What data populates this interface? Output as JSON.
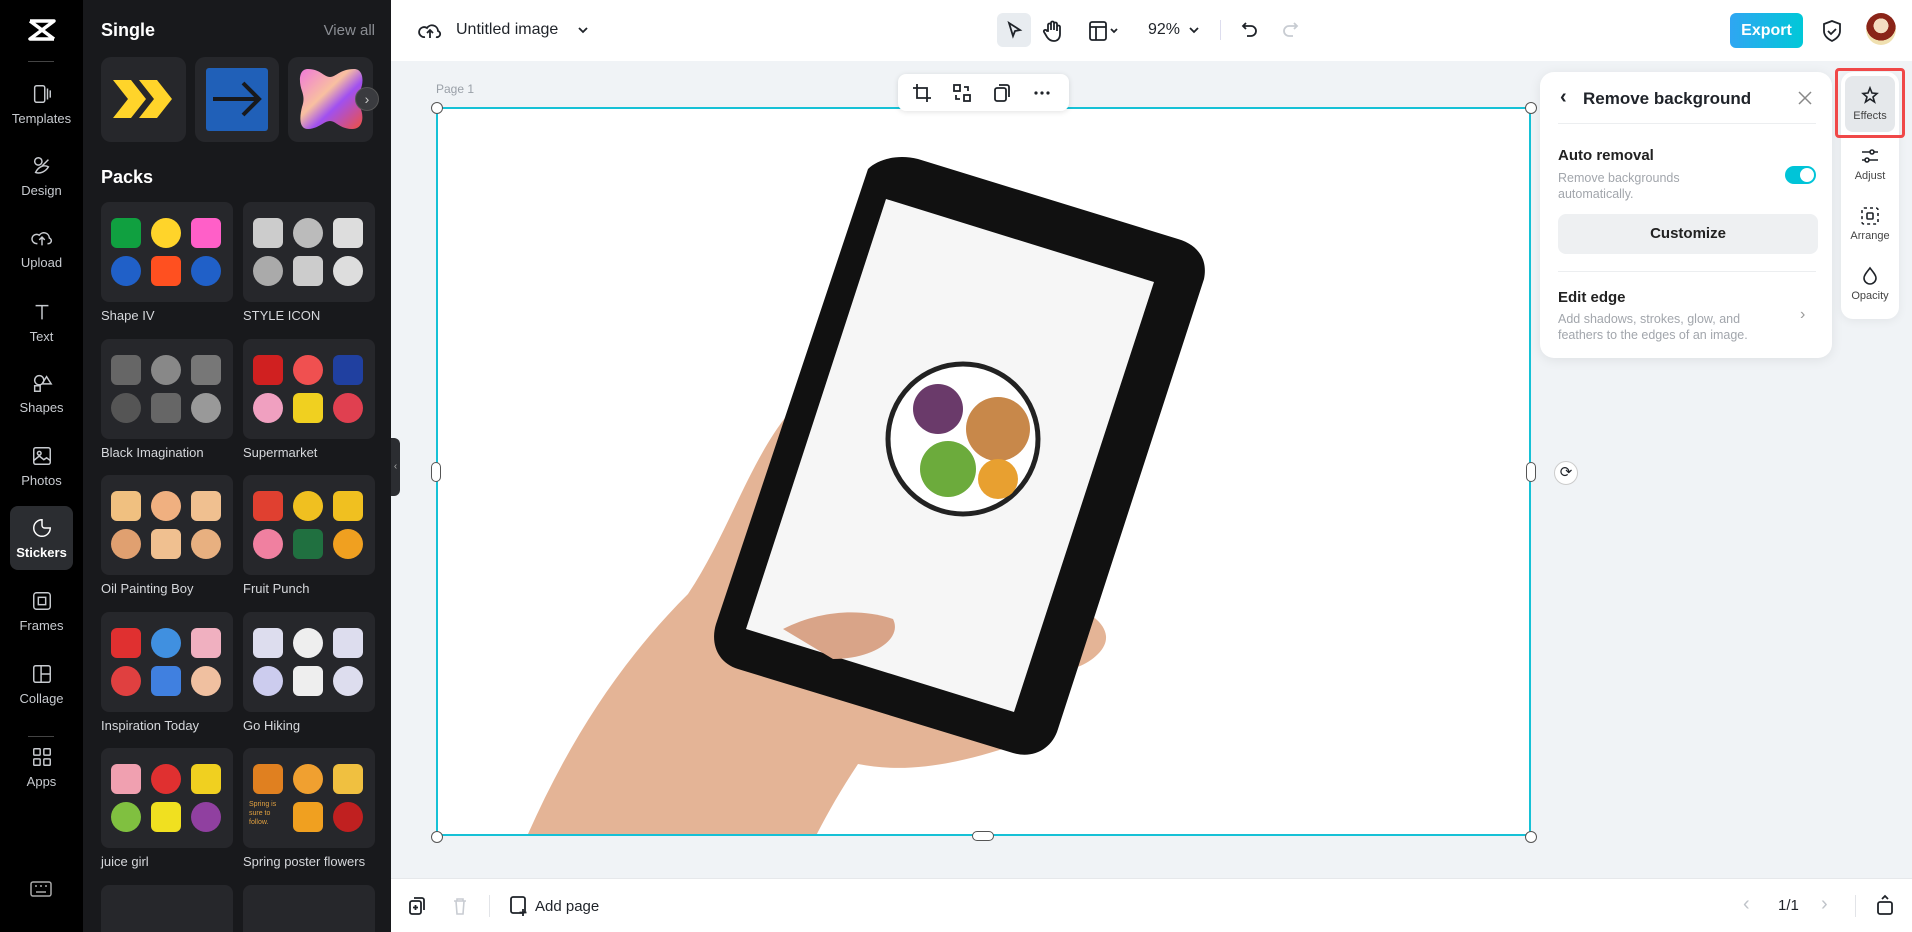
{
  "rail": {
    "items": [
      {
        "label": "Templates",
        "icon": "templates-icon"
      },
      {
        "label": "Design",
        "icon": "design-icon"
      },
      {
        "label": "Upload",
        "icon": "upload-cloud-icon"
      },
      {
        "label": "Text",
        "icon": "text-icon"
      },
      {
        "label": "Shapes",
        "icon": "shapes-icon"
      },
      {
        "label": "Photos",
        "icon": "photo-icon"
      },
      {
        "label": "Stickers",
        "icon": "sticker-icon",
        "active": true
      },
      {
        "label": "Frames",
        "icon": "frame-icon"
      },
      {
        "label": "Collage",
        "icon": "collage-icon"
      },
      {
        "label": "Apps",
        "icon": "apps-icon"
      }
    ]
  },
  "panel": {
    "single_title": "Single",
    "view_all": "View all",
    "packs_title": "Packs",
    "packs": [
      "Shape IV",
      "STYLE ICON",
      "Black Imagination",
      "Supermarket",
      "Oil Painting Boy",
      "Fruit Punch",
      "Inspiration Today",
      "Go Hiking",
      "juice girl",
      "Spring poster flowers"
    ],
    "spring_text": "Spring is sure to follow."
  },
  "topbar": {
    "title": "Untitled image",
    "zoom": "92%",
    "export": "Export"
  },
  "canvas": {
    "page_label": "Page 1"
  },
  "remove_bg": {
    "title": "Remove background",
    "auto_title": "Auto removal",
    "auto_desc": "Remove backgrounds automatically.",
    "auto_enabled": true,
    "customize": "Customize",
    "edge_title": "Edit edge",
    "edge_desc": "Add shadows, strokes, glow, and feathers to the edges of an image."
  },
  "tools": [
    "Effects",
    "Adjust",
    "Arrange",
    "Opacity"
  ],
  "bottombar": {
    "add_page": "Add page",
    "page_count": "1/1"
  },
  "colors": {
    "accent": "#00c4d8",
    "export_gradient": [
      "#2fa6f2",
      "#00c8d8"
    ],
    "highlight": "#f04848"
  }
}
